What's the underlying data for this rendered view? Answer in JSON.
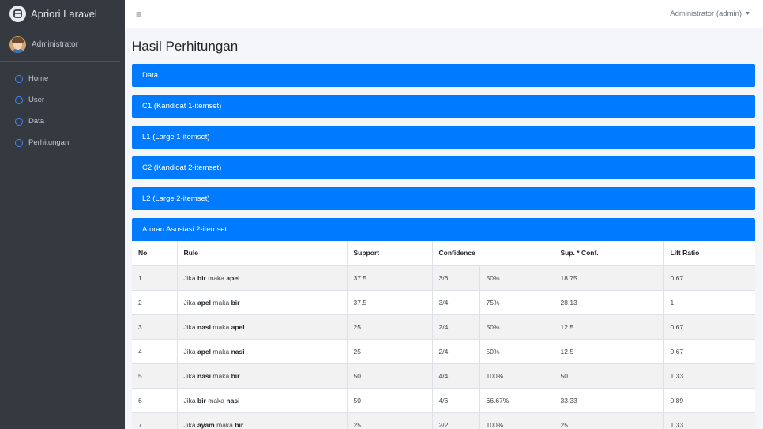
{
  "brand": {
    "name": "Apriori Laravel"
  },
  "sidebar": {
    "user_name": "Administrator",
    "items": [
      {
        "label": "Home"
      },
      {
        "label": "User"
      },
      {
        "label": "Data"
      },
      {
        "label": "Perhitungan"
      }
    ]
  },
  "topbar": {
    "menu_icon": "≡",
    "user_label": "Administrator (admin)"
  },
  "page": {
    "title": "Hasil Perhitungan",
    "panels": [
      {
        "label": "Data"
      },
      {
        "label": "C1 (Kandidat 1-itemset)"
      },
      {
        "label": "L1 (Large 1-itemset)"
      },
      {
        "label": "C2 (Kandidat 2-itemset)"
      },
      {
        "label": "L2 (Large 2-itemset)"
      }
    ],
    "assoc": {
      "label": "Aturan Asosiasi 2-itemset",
      "headers": {
        "no": "No",
        "rule": "Rule",
        "support": "Support",
        "confidence": "Confidence",
        "supconf": "Sup. * Conf.",
        "lift": "Lift Ratio"
      },
      "rows": [
        {
          "no": "1",
          "w1": "Jika",
          "a": "bir",
          "w2": "maka",
          "b": "apel",
          "support": "37.5",
          "conf_frac": "3/6",
          "conf_pct": "50%",
          "supconf": "18.75",
          "lift": "0.67"
        },
        {
          "no": "2",
          "w1": "Jika",
          "a": "apel",
          "w2": "maka",
          "b": "bir",
          "support": "37.5",
          "conf_frac": "3/4",
          "conf_pct": "75%",
          "supconf": "28.13",
          "lift": "1"
        },
        {
          "no": "3",
          "w1": "Jika",
          "a": "nasi",
          "w2": "maka",
          "b": "apel",
          "support": "25",
          "conf_frac": "2/4",
          "conf_pct": "50%",
          "supconf": "12.5",
          "lift": "0.67"
        },
        {
          "no": "4",
          "w1": "Jika",
          "a": "apel",
          "w2": "maka",
          "b": "nasi",
          "support": "25",
          "conf_frac": "2/4",
          "conf_pct": "50%",
          "supconf": "12.5",
          "lift": "0.67"
        },
        {
          "no": "5",
          "w1": "Jika",
          "a": "nasi",
          "w2": "maka",
          "b": "bir",
          "support": "50",
          "conf_frac": "4/4",
          "conf_pct": "100%",
          "supconf": "50",
          "lift": "1.33"
        },
        {
          "no": "6",
          "w1": "Jika",
          "a": "bir",
          "w2": "maka",
          "b": "nasi",
          "support": "50",
          "conf_frac": "4/6",
          "conf_pct": "66.67%",
          "supconf": "33.33",
          "lift": "0.89"
        },
        {
          "no": "7",
          "w1": "Jika",
          "a": "ayam",
          "w2": "maka",
          "b": "bir",
          "support": "25",
          "conf_frac": "2/2",
          "conf_pct": "100%",
          "supconf": "25",
          "lift": "1.33"
        }
      ]
    }
  },
  "colors": {
    "sidebar": "#343a40",
    "primary": "#007bff",
    "background": "#f4f6f9"
  }
}
